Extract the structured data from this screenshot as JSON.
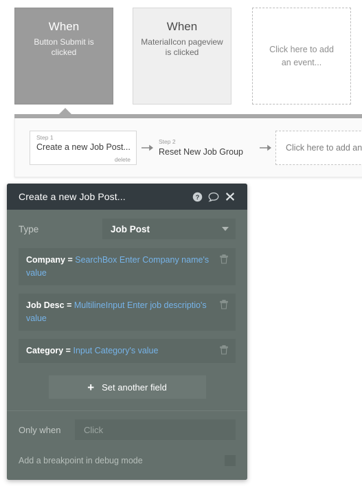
{
  "events": {
    "items": [
      {
        "title": "When",
        "subtitle": "Button Submit is clicked",
        "selected": true
      },
      {
        "title": "When",
        "subtitle": "MaterialIcon pageview is clicked",
        "selected": false
      }
    ],
    "add_placeholder": "Click here to add an event..."
  },
  "workflow": {
    "steps": [
      {
        "label": "Step 1",
        "title": "Create a new Job Post...",
        "delete_label": "delete"
      },
      {
        "label": "Step 2",
        "title": "Reset New Job Group"
      }
    ],
    "add_placeholder": "Click here to add an a"
  },
  "action_panel": {
    "title": "Create a new Job Post...",
    "header_icons": {
      "help": "?",
      "comment": "comment-icon",
      "close": "✕"
    },
    "type": {
      "label": "Type",
      "value": "Job Post"
    },
    "fields": [
      {
        "name": "Company",
        "operator": "=",
        "value": "SearchBox Enter Company name's value"
      },
      {
        "name": "Job Desc",
        "operator": "=",
        "value": "MultilineInput Enter job descriptio's value"
      },
      {
        "name": "Category",
        "operator": "=",
        "value": "Input Category's value"
      }
    ],
    "set_another_field": {
      "icon": "+",
      "label": "Set another field"
    },
    "only_when": {
      "label": "Only when",
      "placeholder": "Click",
      "value": ""
    },
    "breakpoint": {
      "label": "Add a breakpoint in debug mode",
      "checked": false
    }
  },
  "colors": {
    "panel_header": "#333b40",
    "panel_body": "#64706c",
    "field_row": "#5d6965",
    "expression_blue": "#76b3e8",
    "selected_event": "#9b9b9b",
    "connector": "#a8a8a8"
  }
}
